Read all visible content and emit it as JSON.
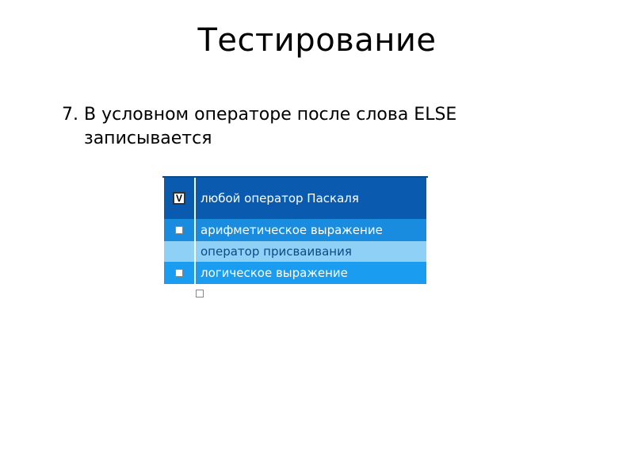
{
  "title": "Тестирование",
  "question": {
    "number": "7.",
    "line1": "В условном операторе после слова ELSE",
    "line2": "записывается"
  },
  "answers": {
    "option1": {
      "label": "любой оператор Паскаля",
      "checked": true,
      "mark": "V"
    },
    "option2": {
      "label": "арифметическое выражение",
      "checked": false
    },
    "option3": {
      "label": "оператор присваивания",
      "checked": false
    },
    "option4": {
      "label": "логическое выражение",
      "checked": false
    }
  }
}
